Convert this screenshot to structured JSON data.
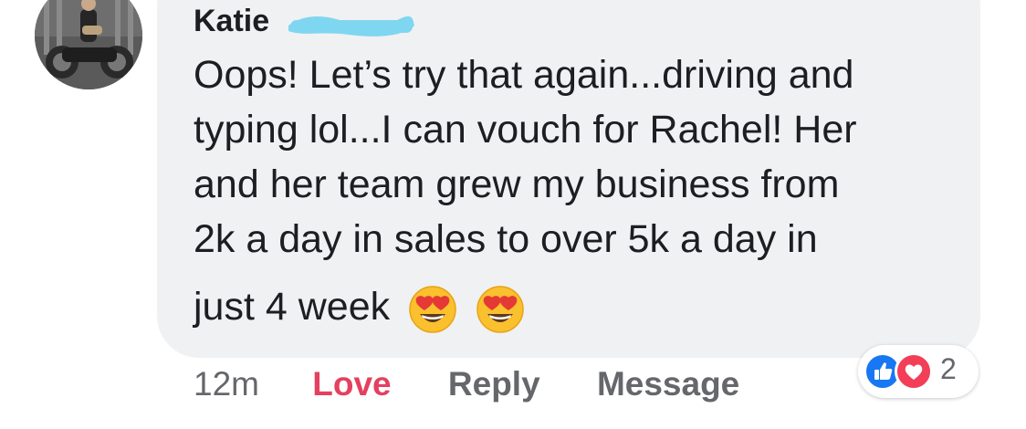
{
  "comment": {
    "author_name": "Katie",
    "body_lines": [
      "Oops! Let’s try that again...driving and",
      "typing lol...I can vouch for Rachel! Her",
      "and her team grew my business from",
      "2k a day in sales to over 5k a day in"
    ],
    "last_line": "just 4 week",
    "emoji_count": 2,
    "emoji_icon": "heart-eyes-emoji-icon"
  },
  "actions": {
    "timestamp": "12m",
    "love_label": "Love",
    "reply_label": "Reply",
    "message_label": "Message"
  },
  "reactions": {
    "icons": [
      "like-icon",
      "love-icon"
    ],
    "count": "2"
  },
  "colors": {
    "bubble": "#f0f1f3",
    "text": "#1c1e21",
    "meta": "#65676b",
    "love": "#e4405f",
    "like_blue": "#1877f2",
    "love_red": "#f33e58",
    "redaction": "#7fd6f0"
  }
}
